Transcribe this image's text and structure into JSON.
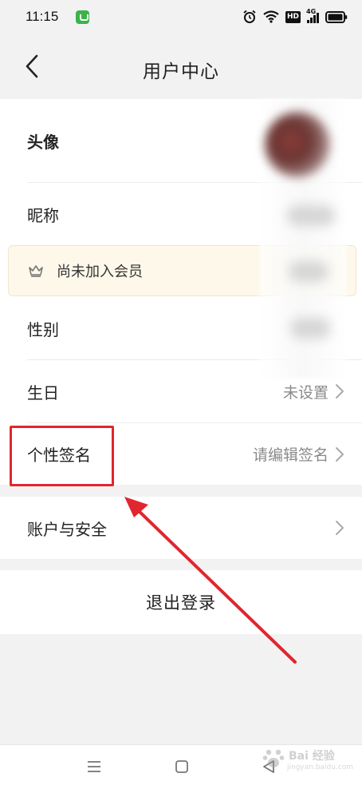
{
  "status_bar": {
    "time": "11:15",
    "icons": [
      "app-notification-icon",
      "alarm-icon",
      "wifi-icon",
      "hd-icon",
      "signal-4g-icon",
      "battery-icon"
    ],
    "hd_label": "HD",
    "network_label": "4G"
  },
  "header": {
    "title": "用户中心",
    "back_icon": "chevron-left-icon"
  },
  "profile_rows": [
    {
      "label": "头像",
      "value": ""
    },
    {
      "label": "昵称",
      "value": ""
    },
    {
      "label": "性别",
      "value": ""
    },
    {
      "label": "生日",
      "value": "未设置"
    },
    {
      "label": "个性签名",
      "value": "请编辑签名"
    }
  ],
  "membership": {
    "icon": "crown-icon",
    "text": "尚未加入会员"
  },
  "account": {
    "label": "账户与安全"
  },
  "logout": {
    "label": "退出登录"
  },
  "system_nav": {
    "icons": [
      "menu-icon",
      "home-icon",
      "back-triangle-icon"
    ]
  },
  "annotation": {
    "color": "#e0262e"
  },
  "watermark": {
    "text": "Bai 经验",
    "subtext": "jingyan.baidu.com"
  },
  "colors": {
    "page_bg": "#f2f2f2",
    "card_bg": "#ffffff",
    "member_bg": "#fdf8e9",
    "value_gray": "#8a8a8a"
  }
}
